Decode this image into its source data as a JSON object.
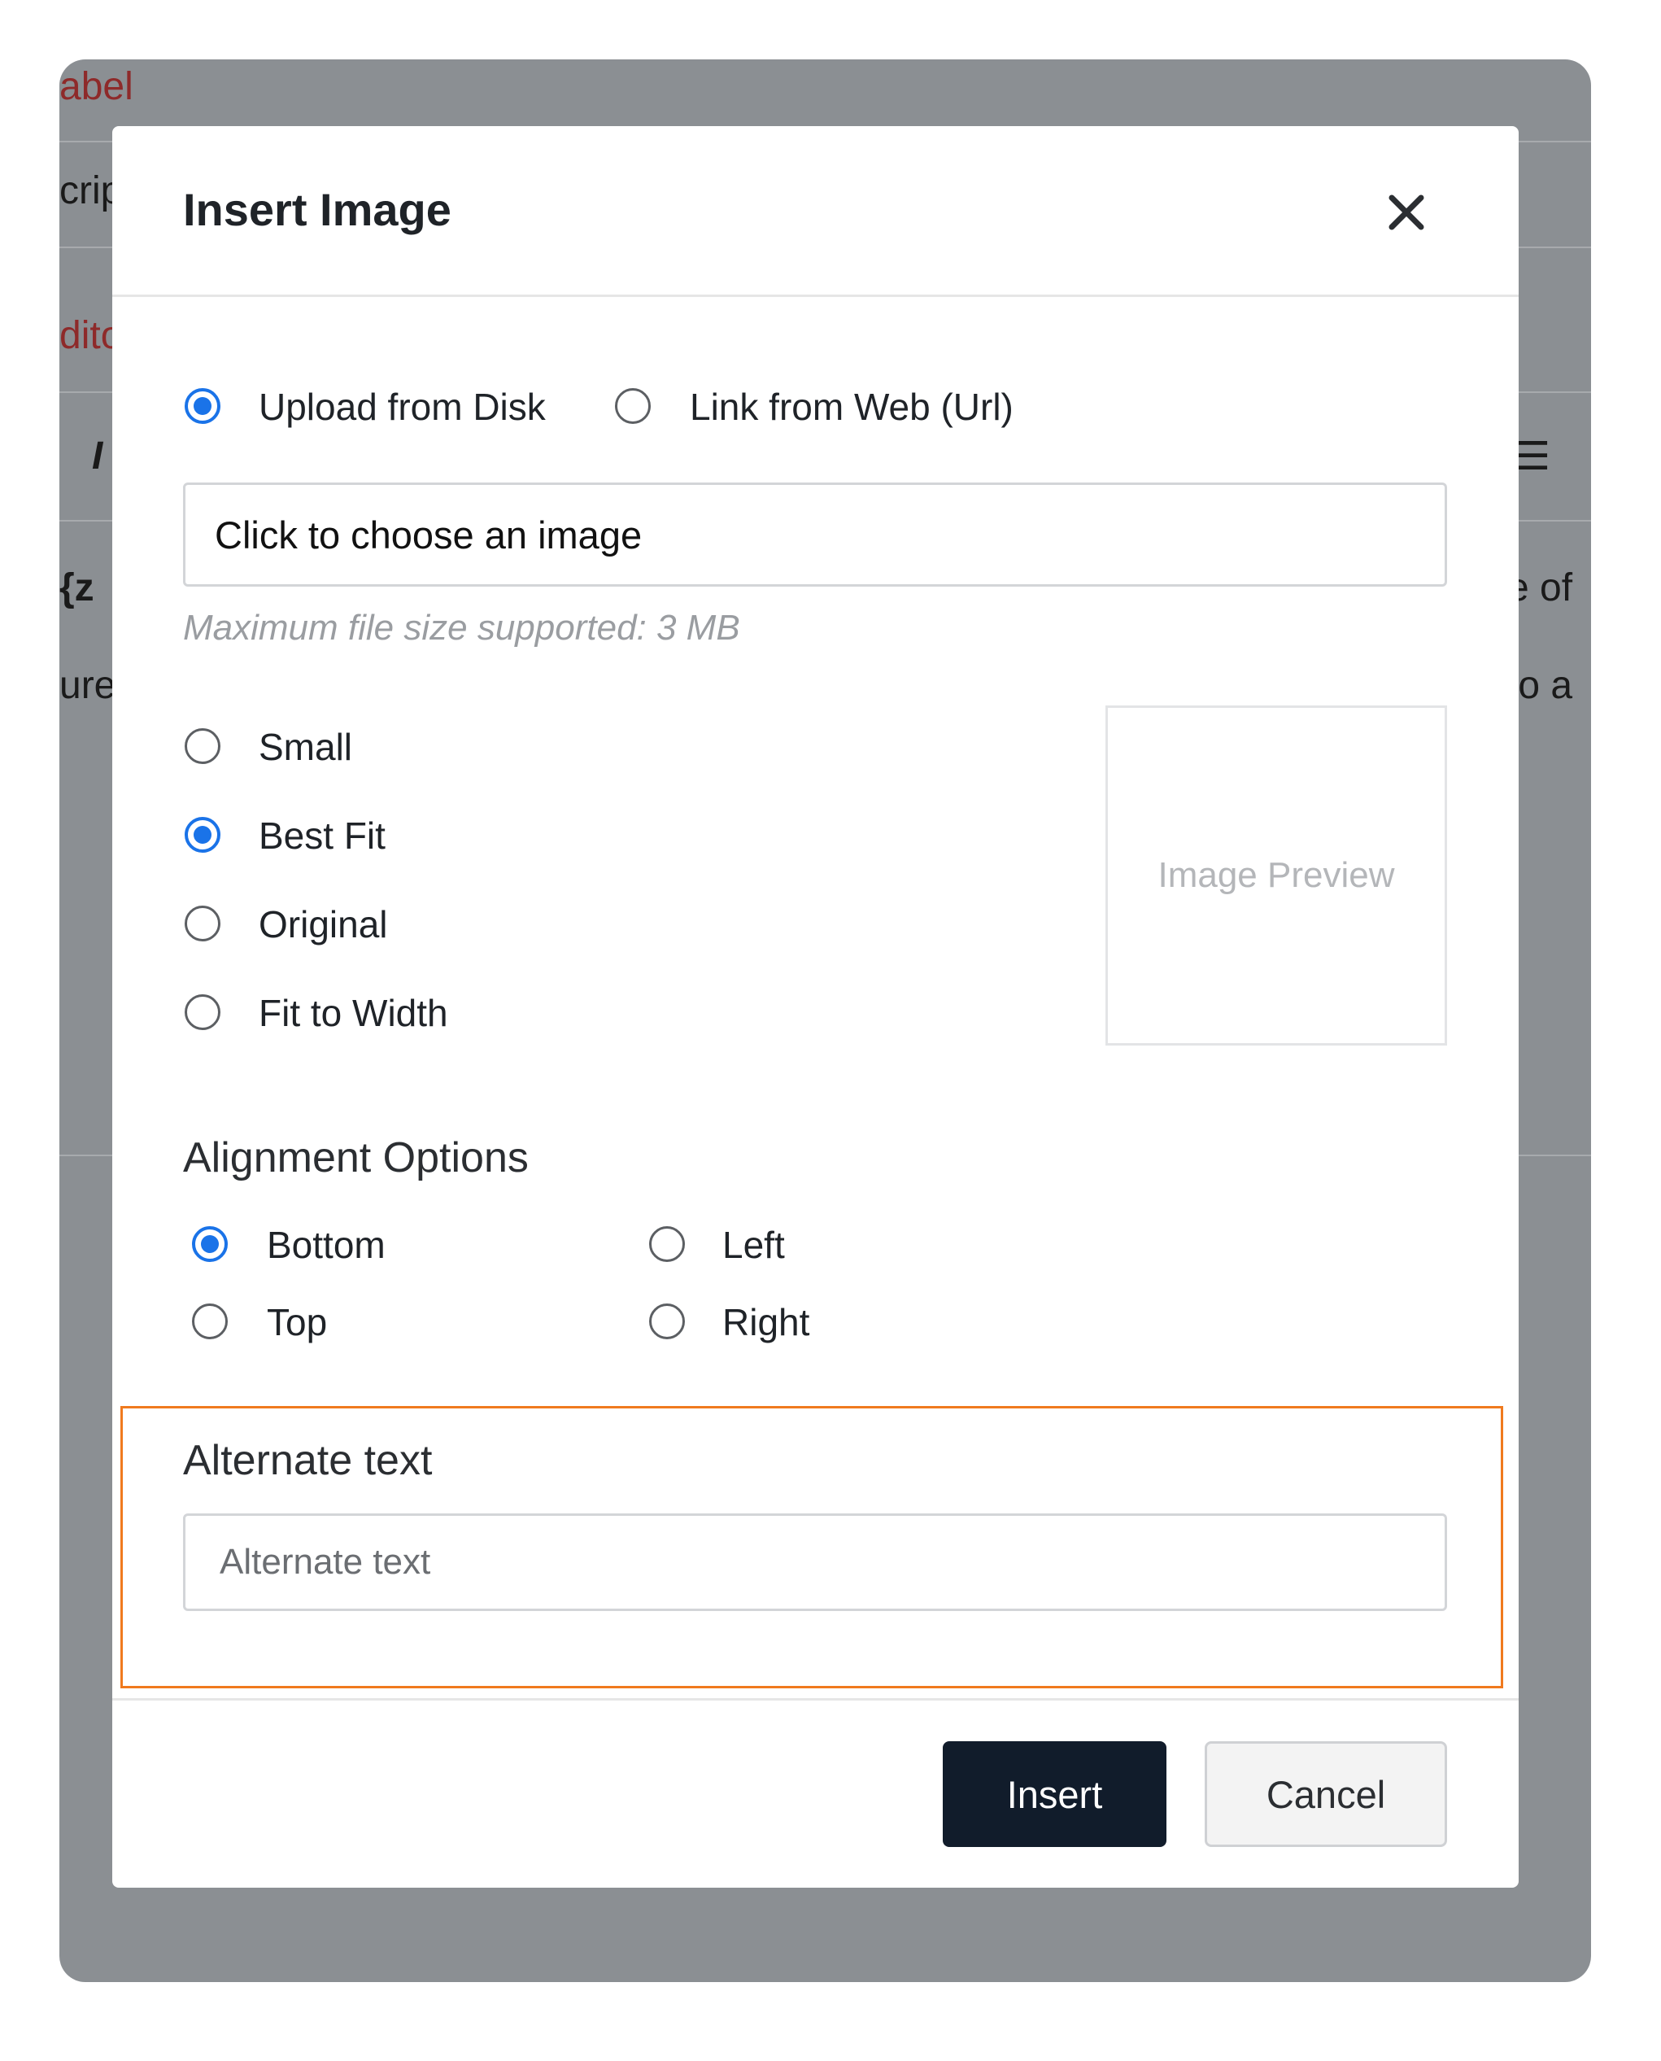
{
  "background": {
    "fragments": [
      "abel",
      "crip",
      "dito",
      "I",
      "{z",
      "ure",
      "e of",
      "to a",
      "☰"
    ]
  },
  "modal": {
    "title": "Insert Image",
    "close_icon": "close-icon",
    "source": {
      "options": [
        "Upload from Disk",
        "Link from Web (Url)"
      ],
      "selected": "Upload from Disk"
    },
    "file_input": {
      "label": "Click to choose an image"
    },
    "hint": "Maximum file size supported: 3 MB",
    "size": {
      "options": [
        "Small",
        "Best Fit",
        "Original",
        "Fit to Width"
      ],
      "selected": "Best Fit"
    },
    "preview": {
      "label": "Image Preview"
    },
    "alignment": {
      "title": "Alignment Options",
      "options": [
        "Bottom",
        "Left",
        "Top",
        "Right"
      ],
      "selected": "Bottom"
    },
    "alt_text": {
      "title": "Alternate text",
      "placeholder": "Alternate text",
      "value": ""
    },
    "buttons": {
      "insert": "Insert",
      "cancel": "Cancel"
    }
  },
  "colors": {
    "accent": "#1a73e8",
    "primary_button": "#111c2b",
    "highlight_border": "#f07a1e",
    "backdrop": "#8b8f93"
  }
}
